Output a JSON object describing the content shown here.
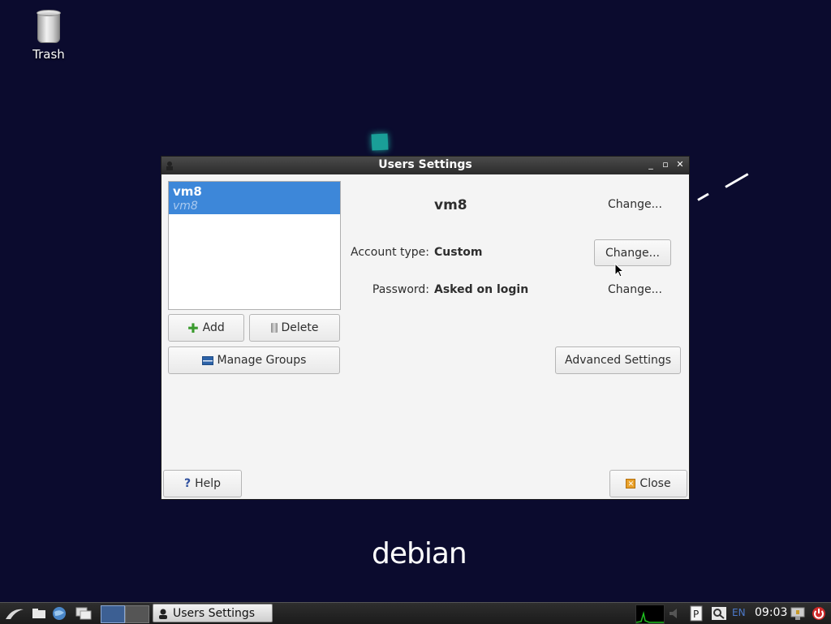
{
  "desktop": {
    "trash_label": "Trash",
    "logo_text": "debian"
  },
  "window": {
    "title": "Users Settings",
    "user_list": [
      {
        "name": "vm8",
        "subtitle": "vm8"
      }
    ],
    "buttons": {
      "add": "Add",
      "delete": "Delete",
      "manage_groups": "Manage Groups",
      "help": "Help",
      "close": "Close",
      "advanced_settings": "Advanced Settings"
    },
    "details": {
      "username": "vm8",
      "change_name": "Change...",
      "account_type_label": "Account type:",
      "account_type_value": "Custom",
      "change_account_type": "Change...",
      "password_label": "Password:",
      "password_value": "Asked on login",
      "change_password": "Change..."
    }
  },
  "taskbar": {
    "active_task": "Users Settings",
    "language": "EN",
    "clock": "09:03"
  },
  "colors": {
    "desktop_bg": "#0b0b2e",
    "selection": "#3d87d9",
    "titlebar": "#2b2b2b"
  }
}
